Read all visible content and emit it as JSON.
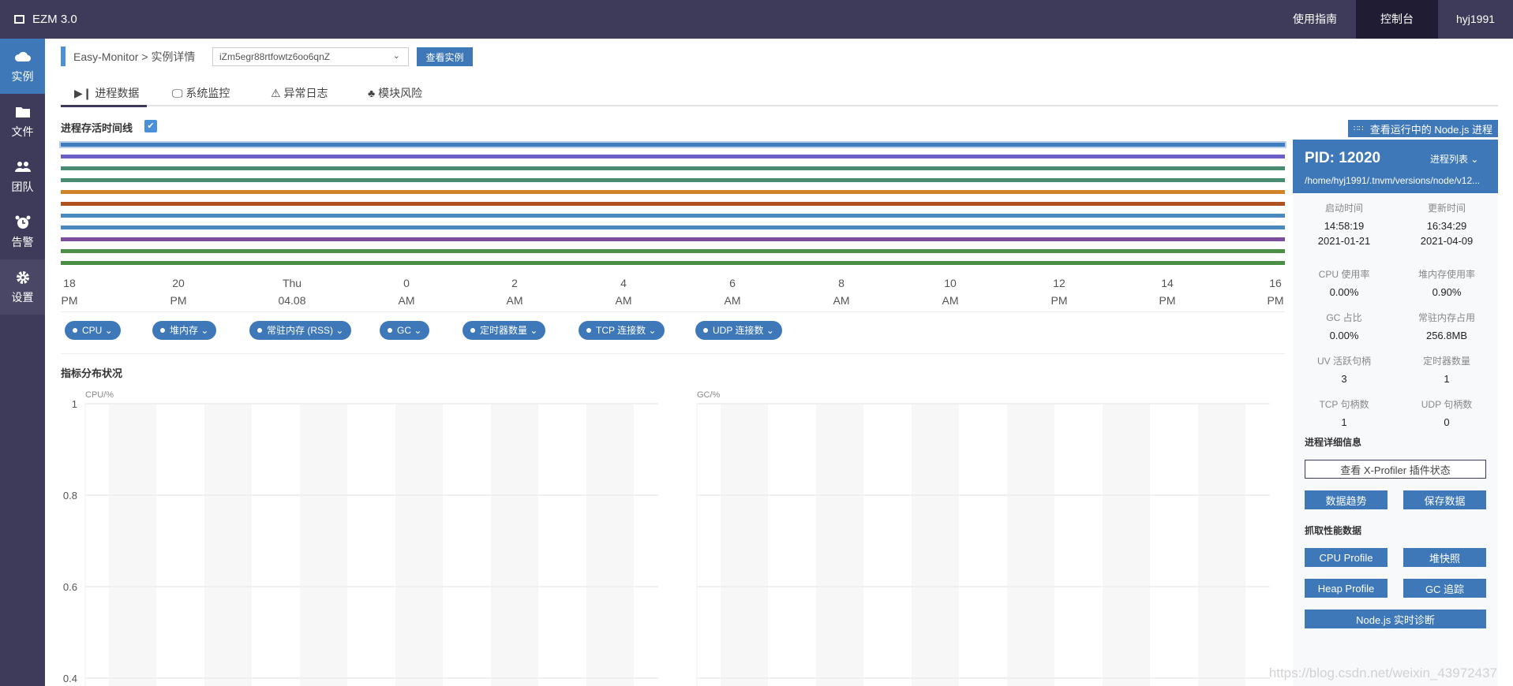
{
  "topbar": {
    "title": "EZM 3.0",
    "nav": [
      "使用指南",
      "控制台",
      "hyj1991"
    ],
    "active_nav": "控制台",
    "bg": "#3e3a5a"
  },
  "sidebar": {
    "items": [
      {
        "label": "实例",
        "icon": "cloud-icon",
        "active": true
      },
      {
        "label": "文件",
        "icon": "folder-icon"
      },
      {
        "label": "团队",
        "icon": "team-icon"
      },
      {
        "label": "告警",
        "icon": "alarm-icon"
      },
      {
        "label": "设置",
        "icon": "gear-icon"
      }
    ]
  },
  "breadcrumb": {
    "root": "Easy-Monitor",
    "sep": ">",
    "current": "实例详情"
  },
  "instance_select": {
    "value": "iZm5egr88rtfowtz6oo6qnZ"
  },
  "view_instance_button": "查看实例",
  "tabs": [
    {
      "label": "进程数据",
      "icon": "play-icon",
      "active": true
    },
    {
      "label": "系统监控",
      "icon": "monitor-icon"
    },
    {
      "label": "异常日志",
      "icon": "warning-icon"
    },
    {
      "label": "模块风险",
      "icon": "module-icon"
    }
  ],
  "timeline": {
    "label": "进程存活时间线",
    "checked": true,
    "line_colors": [
      "#3f7dc0",
      "#6a5fc6",
      "#4a8c72",
      "#4a8c72",
      "#d3842b",
      "#b0521f",
      "#4a89c0",
      "#4a89c0",
      "#7b4f9d",
      "#4b8f45",
      "#4b8f45"
    ],
    "x_labels": [
      [
        "18",
        "PM"
      ],
      [
        "20",
        "PM"
      ],
      [
        "Thu",
        "04.08"
      ],
      [
        "0",
        "AM"
      ],
      [
        "2",
        "AM"
      ],
      [
        "4",
        "AM"
      ],
      [
        "6",
        "AM"
      ],
      [
        "8",
        "AM"
      ],
      [
        "10",
        "AM"
      ],
      [
        "12",
        "PM"
      ],
      [
        "14",
        "PM"
      ],
      [
        "16",
        "PM"
      ]
    ]
  },
  "metric_chips": [
    "CPU",
    "堆内存",
    "常驻内存 (RSS)",
    "GC",
    "定时器数量",
    "TCP 连接数",
    "UDP 连接数"
  ],
  "distribution_title": "指标分布状况",
  "chart_data": [
    {
      "type": "bar",
      "ylabel": "CPU/%",
      "yticks": [
        1,
        0.8,
        0.6,
        0.4
      ],
      "ylim": [
        0.4,
        1
      ],
      "series": [],
      "grid": true
    },
    {
      "type": "bar",
      "ylabel": "GC/%",
      "yticks": [
        1,
        0.8,
        0.6,
        0.4
      ],
      "ylim": [
        0.4,
        1
      ],
      "series": [],
      "grid": true
    }
  ],
  "right_panel": {
    "view_running_button": "查看运行中的 Node.js 进程",
    "pid": "PID: 12020",
    "process_list": "进程列表",
    "path": "/home/hyj1991/.tnvm/versions/node/v12...",
    "stats": [
      {
        "k": "启动时间",
        "v": "14:58:19",
        "v2": "2021-01-21"
      },
      {
        "k": "更新时间",
        "v": "16:34:29",
        "v2": "2021-04-09"
      },
      {
        "k": "CPU 使用率",
        "v": "0.00%"
      },
      {
        "k": "堆内存使用率",
        "v": "0.90%"
      },
      {
        "k": "GC 占比",
        "v": "0.00%"
      },
      {
        "k": "常驻内存占用",
        "v": "256.8MB"
      },
      {
        "k": "UV 活跃句柄",
        "v": "3"
      },
      {
        "k": "定时器数量",
        "v": "1"
      },
      {
        "k": "TCP 句柄数",
        "v": "1"
      },
      {
        "k": "UDP 句柄数",
        "v": "0"
      }
    ],
    "detail_title": "进程详细信息",
    "xprofiler_button": "查看 X-Profiler 插件状态",
    "trend_button": "数据趋势",
    "save_button": "保存数据",
    "capture_title": "抓取性能数据",
    "cpu_profile_button": "CPU Profile",
    "heap_snapshot_button": "堆快照",
    "heap_profile_button": "Heap Profile",
    "gc_trace_button": "GC 追踪",
    "diag_button": "Node.js 实时诊断"
  },
  "watermark": "https://blog.csdn.net/weixin_43972437"
}
